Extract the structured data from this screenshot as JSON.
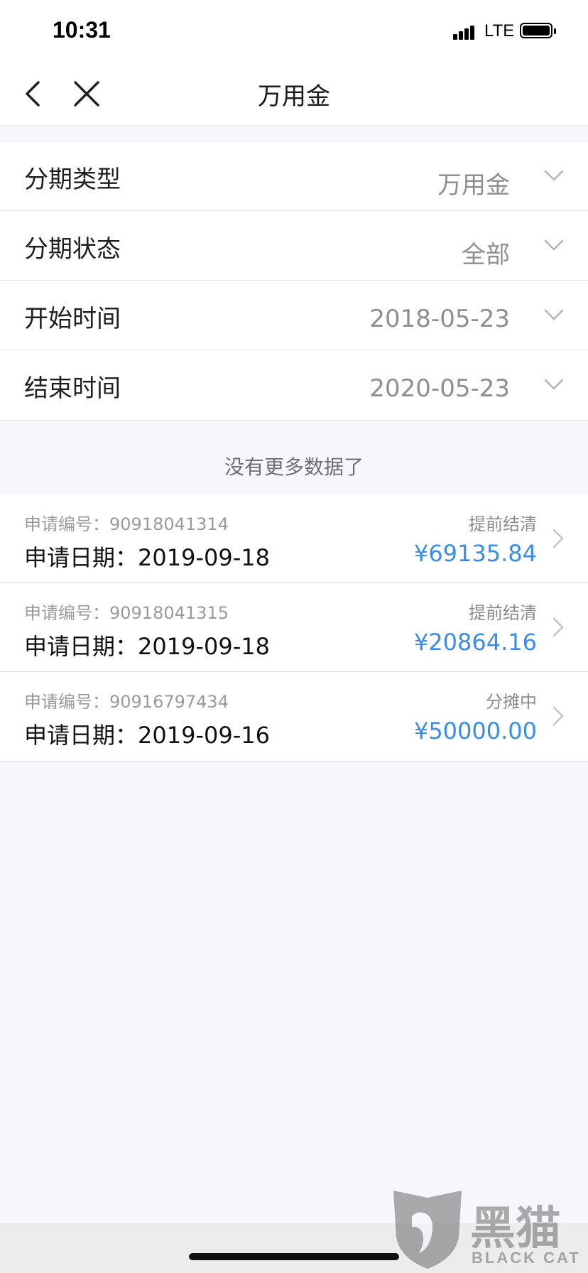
{
  "status_bar": {
    "time": "10:31",
    "network": "LTE"
  },
  "nav": {
    "title": "万用金"
  },
  "filters": [
    {
      "label": "分期类型",
      "value": "万用金"
    },
    {
      "label": "分期状态",
      "value": "全部"
    },
    {
      "label": "开始时间",
      "value": "2018-05-23"
    },
    {
      "label": "结束时间",
      "value": "2020-05-23"
    }
  ],
  "list": {
    "no_more_text": "没有更多数据了",
    "records": [
      {
        "number_text": "申请编号：90918041314",
        "date_text": "申请日期：2019-09-18",
        "status": "提前结清",
        "amount": "¥69135.84"
      },
      {
        "number_text": "申请编号：90918041315",
        "date_text": "申请日期：2019-09-18",
        "status": "提前结清",
        "amount": "¥20864.16"
      },
      {
        "number_text": "申请编号：90916797434",
        "date_text": "申请日期：2019-09-16",
        "status": "分摊中",
        "amount": "¥50000.00"
      }
    ]
  },
  "watermark": {
    "cn": "黑猫",
    "en": "BLACK CAT"
  },
  "colors": {
    "accent": "#3a8ee6",
    "background": "#f6f7fb"
  },
  "icons": [
    "back-icon",
    "close-icon",
    "chevron-down-icon",
    "chevron-right-icon",
    "cat-logo-icon"
  ]
}
